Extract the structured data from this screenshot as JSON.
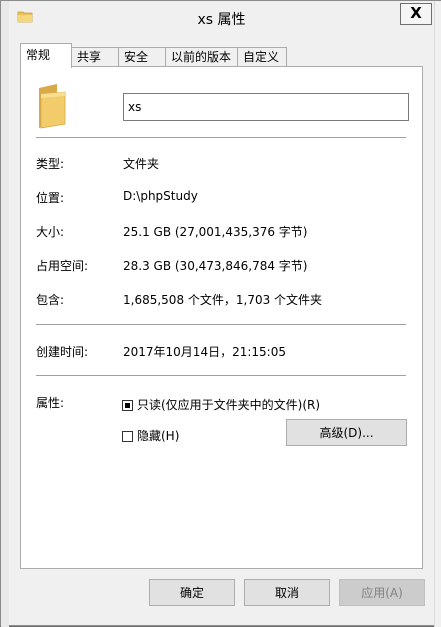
{
  "window": {
    "title": "xs 属性",
    "close_glyph": "X"
  },
  "tabs": [
    {
      "label": "常规",
      "active": true
    },
    {
      "label": "共享",
      "active": false
    },
    {
      "label": "安全",
      "active": false
    },
    {
      "label": "以前的版本",
      "active": false
    },
    {
      "label": "自定义",
      "active": false
    }
  ],
  "general": {
    "folder_name": "xs",
    "type_label": "类型:",
    "type_value": "文件夹",
    "location_label": "位置:",
    "location_value": "D:\\phpStudy",
    "size_label": "大小:",
    "size_value": "25.1 GB (27,001,435,376 字节)",
    "disk_size_label": "占用空间:",
    "disk_size_value": "28.3 GB (30,473,846,784 字节)",
    "contains_label": "包含:",
    "contains_value": "1,685,508 个文件，1,703 个文件夹",
    "created_label": "创建时间:",
    "created_value": "2017年10月14日，21:15:05",
    "attributes_label": "属性:",
    "readonly_label": "只读(仅应用于文件夹中的文件)(R)",
    "readonly_state": "indeterminate",
    "hidden_label": "隐藏(H)",
    "hidden_checked": false,
    "advanced_button": "高级(D)..."
  },
  "footer": {
    "ok_label": "确定",
    "cancel_label": "取消",
    "apply_label": "应用(A)"
  },
  "colors": {
    "window_bg": "#f0f0f0",
    "panel_bg": "#ffffff",
    "border": "#acacac",
    "button_bg": "#e1e1e1",
    "disabled_text": "#838383"
  },
  "icons": {
    "title_icon": "folder-icon",
    "large_icon": "folder-icon"
  }
}
